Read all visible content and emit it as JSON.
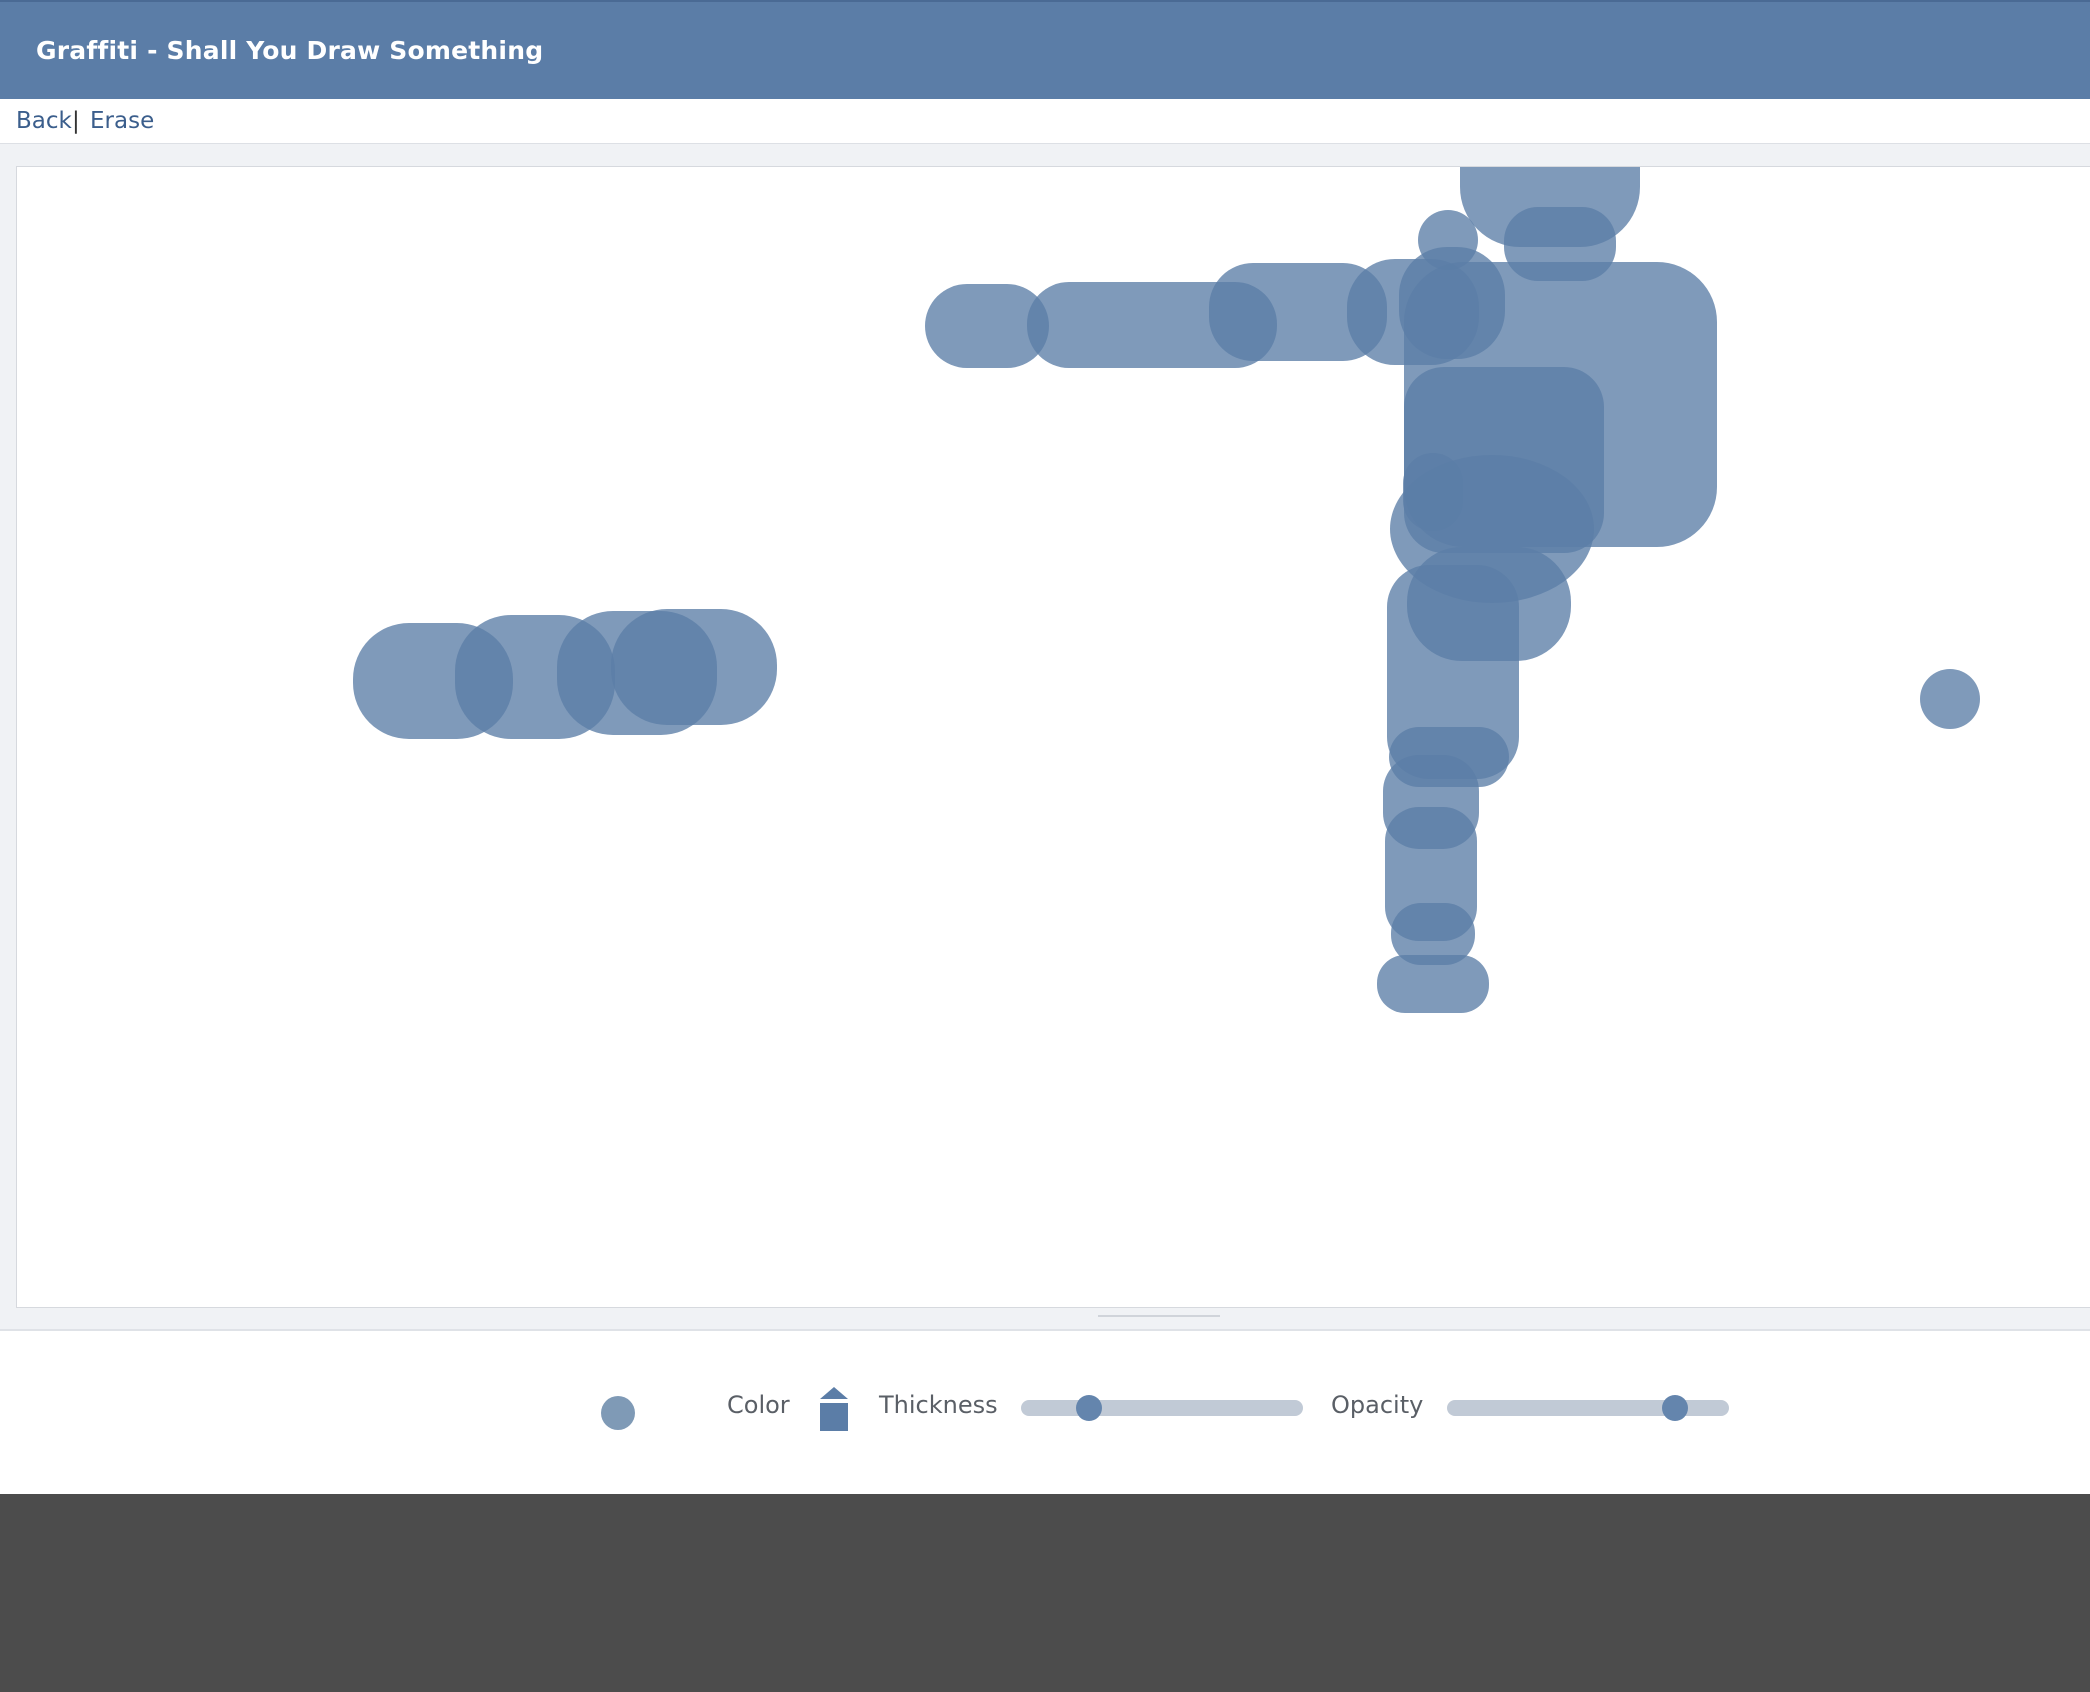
{
  "window": {
    "title": "Graffiti - Shall You Draw Something"
  },
  "nav": {
    "back_label": "Back",
    "separator": "|",
    "erase_label": "Erase"
  },
  "toolbar": {
    "color_label": "Color",
    "thickness_label": "Thickness",
    "opacity_label": "Opacity",
    "thickness_value": 0.24,
    "opacity_value": 0.81,
    "brush_color": "#5b7da7"
  },
  "colors": {
    "header_bg": "#5b7da7",
    "link": "#3b5e8c",
    "stroke": "#5b7da7",
    "slider_track": "#c1cad6",
    "slider_thumb": "#6485ad"
  },
  "icons": {
    "color_swatch": "pencil-color-icon",
    "brush_preview": "brush-preview-dot"
  }
}
